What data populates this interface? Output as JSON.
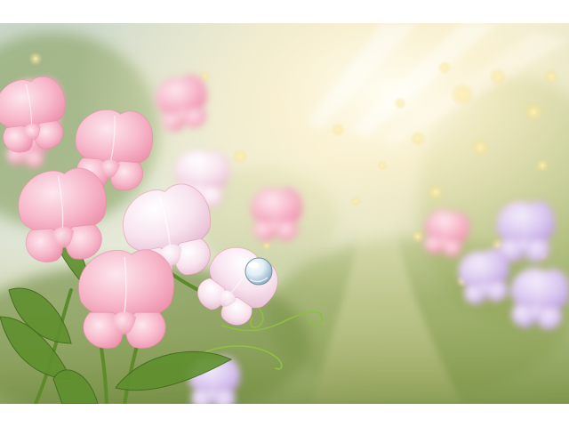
{
  "image": {
    "subject": "sweet-pea-flowers-in-sunlit-garden",
    "colors": {
      "background_white": "#ffffff",
      "petal_pink": "#f6b6c8",
      "petal_light": "#fbe3ec",
      "lavender": "#d7c4ef",
      "leaf_green": "#5f8f2e",
      "sun_glow": "#fff6d8"
    }
  }
}
